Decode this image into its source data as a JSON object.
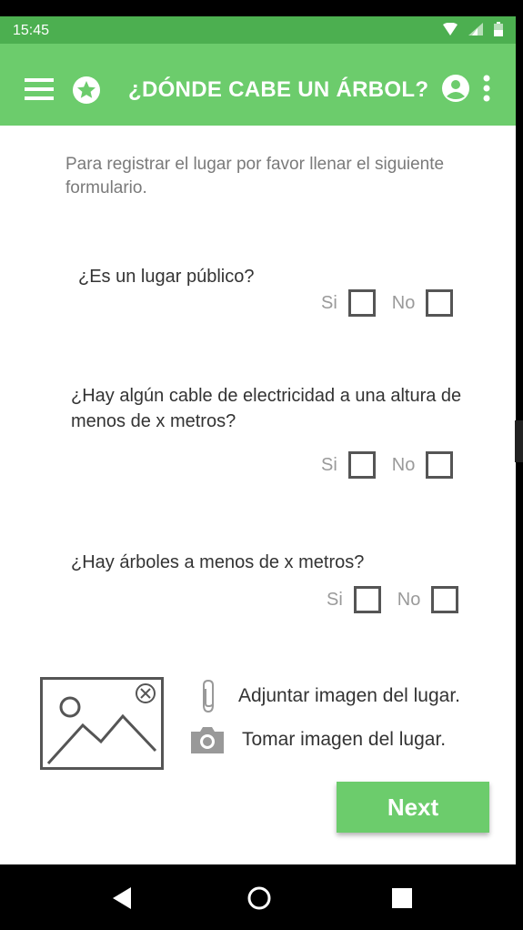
{
  "status": {
    "time": "15:45"
  },
  "app_bar": {
    "title": "¿DÓNDE CABE UN ÁRBOL?"
  },
  "form": {
    "intro": "Para registrar el lugar por favor llenar el siguiente formulario.",
    "questions": [
      {
        "text": "¿Es un lugar público?",
        "yes": "Si",
        "no": "No"
      },
      {
        "text": "¿Hay algún cable de electricidad a una altura de menos de x metros?",
        "yes": "Si",
        "no": "No"
      },
      {
        "text": "¿Hay árboles a menos de x metros?",
        "yes": "Si",
        "no": "No"
      }
    ],
    "attach_label": "Adjuntar imagen del lugar.",
    "camera_label": "Tomar imagen del lugar.",
    "next_label": "Next"
  },
  "colors": {
    "accent": "#6ccc6c",
    "status_bar": "#4caf50"
  }
}
